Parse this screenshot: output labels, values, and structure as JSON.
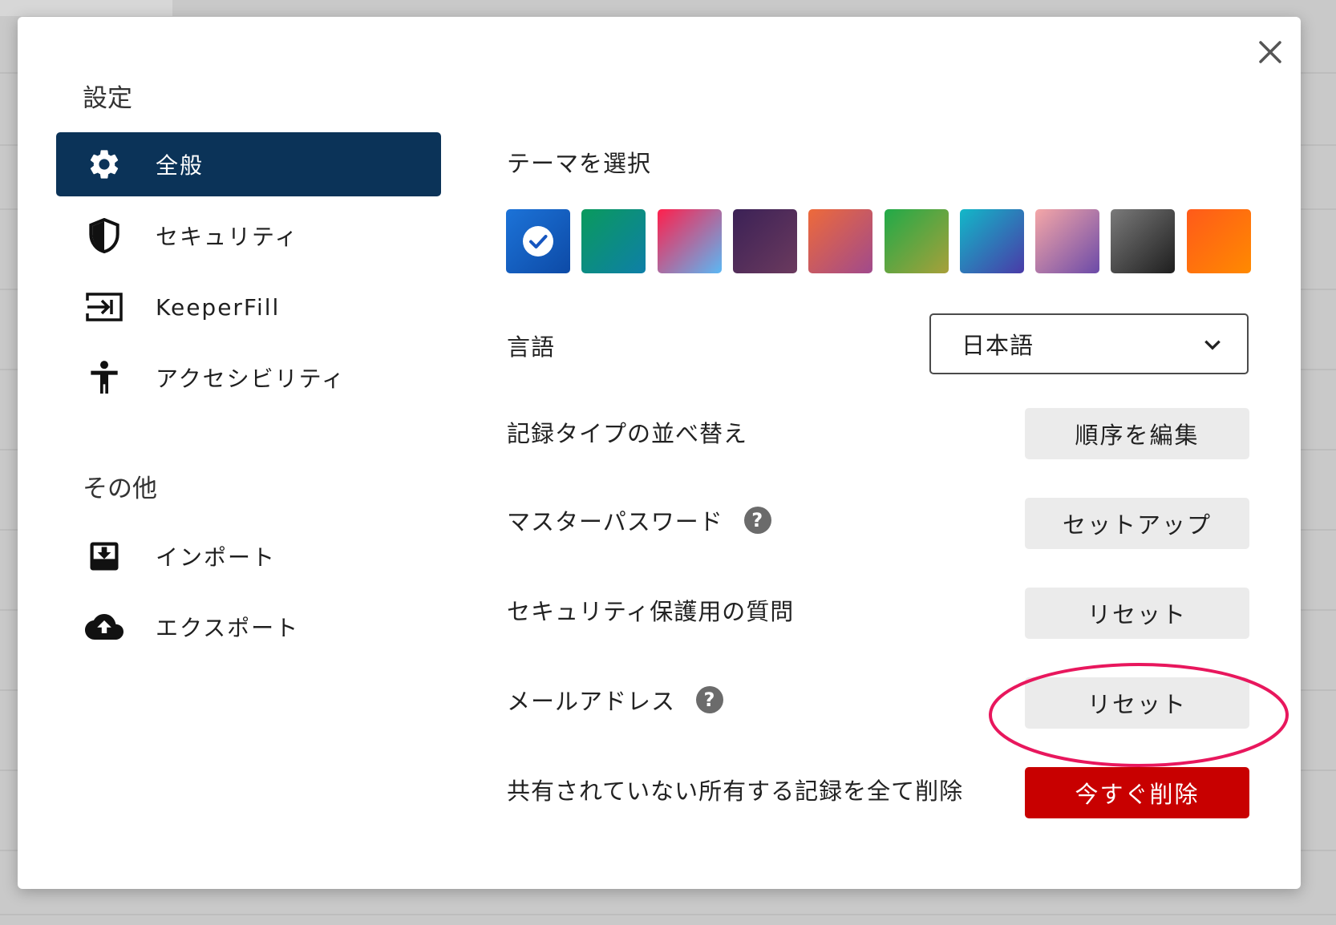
{
  "dialog": {
    "close_label": "×"
  },
  "sidebar": {
    "settings_heading": "設定",
    "other_heading": "その他",
    "items": [
      {
        "label": "全般",
        "icon": "gear-icon",
        "active": true
      },
      {
        "label": "セキュリティ",
        "icon": "shield-icon"
      },
      {
        "label": "KeeperFill",
        "icon": "keeperfill-icon"
      },
      {
        "label": "アクセシビリティ",
        "icon": "accessibility-icon"
      }
    ],
    "other_items": [
      {
        "label": "インポート",
        "icon": "import-icon"
      },
      {
        "label": "エクスポート",
        "icon": "cloud-upload-icon"
      }
    ]
  },
  "main": {
    "theme_label": "テーマを選択",
    "themes": [
      {
        "colors": [
          "#1c73d8",
          "#0d4aa6"
        ],
        "selected": true
      },
      {
        "colors": [
          "#0a9a5c",
          "#0e7fa8"
        ]
      },
      {
        "colors": [
          "#ff1f4b",
          "#5ab8f5"
        ]
      },
      {
        "colors": [
          "#3b2156",
          "#6b3a5e"
        ]
      },
      {
        "colors": [
          "#ee6a3a",
          "#a04a8c"
        ]
      },
      {
        "colors": [
          "#20aa48",
          "#a8a03a"
        ]
      },
      {
        "colors": [
          "#12b8c8",
          "#4a3aa8"
        ]
      },
      {
        "colors": [
          "#f5a7a7",
          "#6b4aa8"
        ]
      },
      {
        "colors": [
          "#7a7a7a",
          "#1e1e1e"
        ]
      },
      {
        "colors": [
          "#ff5a1a",
          "#ff8a00"
        ]
      }
    ],
    "language_label": "言語",
    "language_value": "日本語",
    "sort_label": "記録タイプの並べ替え",
    "sort_button": "順序を編集",
    "master_password_label": "マスターパスワード",
    "master_password_button": "セットアップ",
    "security_question_label": "セキュリティ保護用の質問",
    "security_question_button": "リセット",
    "email_label": "メールアドレス",
    "email_button": "リセット",
    "delete_label": "共有されていない所有する記録を全て削除",
    "delete_button": "今すぐ削除",
    "help_glyph": "?"
  },
  "colors": {
    "active_nav": "#0b3358",
    "danger": "#c80000",
    "highlight_ring": "#e8175d"
  }
}
